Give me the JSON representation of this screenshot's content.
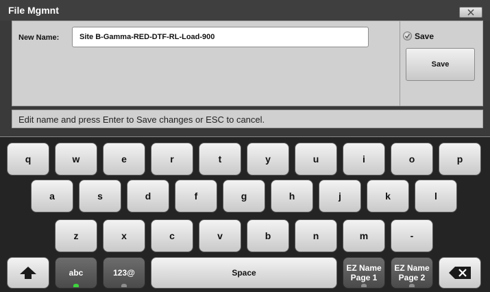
{
  "dialog": {
    "title": "File Mgmnt",
    "name_label": "New Name:",
    "name_value": "Site B-Gamma-RED-DTF-RL-Load-900",
    "save_option_label": "Save",
    "save_button_label": "Save",
    "status_text": "Edit name and press Enter to Save changes or ESC to cancel."
  },
  "keyboard": {
    "row1": [
      "q",
      "w",
      "e",
      "r",
      "t",
      "y",
      "u",
      "i",
      "o",
      "p"
    ],
    "row2": [
      "a",
      "s",
      "d",
      "f",
      "g",
      "h",
      "j",
      "k",
      "l"
    ],
    "row3": [
      "z",
      "x",
      "c",
      "v",
      "b",
      "n",
      "m",
      "-"
    ],
    "abc": "abc",
    "num": "123@",
    "space": "Space",
    "ez1_line1": "EZ Name",
    "ez1_line2": "Page 1",
    "ez2_line1": "EZ Name",
    "ez2_line2": "Page 2",
    "icons": {
      "shift": "shift-up-arrow-icon",
      "backspace": "backspace-icon",
      "close": "close-x-icon"
    }
  }
}
